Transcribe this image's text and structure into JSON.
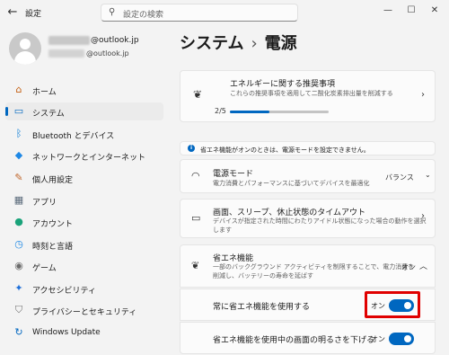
{
  "window": {
    "title": "設定",
    "back_icon": "back-arrow-icon"
  },
  "search": {
    "placeholder": "設定の検索"
  },
  "account": {
    "email_primary": "@outlook.jp",
    "email_secondary": "@outlook.jp"
  },
  "sidebar": {
    "items": [
      {
        "label": "ホーム",
        "icon": "home-icon",
        "color": "#c45f12"
      },
      {
        "label": "システム",
        "icon": "monitor-icon",
        "color": "#0067c0",
        "active": true
      },
      {
        "label": "Bluetooth とデバイス",
        "icon": "bluetooth-icon",
        "color": "#0078d4"
      },
      {
        "label": "ネットワークとインターネット",
        "icon": "wifi-icon",
        "color": "#1e88e5"
      },
      {
        "label": "個人用設定",
        "icon": "brush-icon",
        "color": "#c0652a"
      },
      {
        "label": "アプリ",
        "icon": "apps-icon",
        "color": "#5b6b7b"
      },
      {
        "label": "アカウント",
        "icon": "person-icon",
        "color": "#1aa37a"
      },
      {
        "label": "時刻と言語",
        "icon": "globe-clock-icon",
        "color": "#1e88e5"
      },
      {
        "label": "ゲーム",
        "icon": "gamepad-icon",
        "color": "#6b6b6b"
      },
      {
        "label": "アクセシビリティ",
        "icon": "accessibility-icon",
        "color": "#1e6fd9"
      },
      {
        "label": "プライバシーとセキュリティ",
        "icon": "shield-icon",
        "color": "#707070"
      },
      {
        "label": "Windows Update",
        "icon": "update-icon",
        "color": "#0067c0"
      }
    ]
  },
  "breadcrumb": {
    "parent": "システム",
    "separator": "›",
    "current": "電源"
  },
  "energy_card": {
    "title": "エネルギーに関する推奨事項",
    "description": "これらの推奨事項を適用して二酸化炭素排出量を削減する",
    "progress_text": "2/5",
    "progress_value": 0.4
  },
  "info_bar": {
    "text": "省エネ機能がオンのときは、電源モードを設定できません。"
  },
  "power_mode": {
    "title": "電源モード",
    "description": "電力消費とパフォーマンスに基づいてデバイスを最適化",
    "value": "バランス"
  },
  "screen_sleep": {
    "title": "画面、スリープ、休止状態のタイムアウト",
    "description_1": "デバイスが指定された時間にわたりアイドル状態になった場合の動作を選択",
    "description_2": "します"
  },
  "energy_saver": {
    "title": "省エネ機能",
    "description_1": "一部のバックグラウンド アクティビティを制限することで、電力消費を",
    "description_2": "削減し、バッテリーの寿命を延ばす",
    "status": "オン"
  },
  "always_use": {
    "label": "常に省エネ機能を使用する",
    "state": "オン"
  },
  "lower_brightness": {
    "label": "省エネ機能を使用中の画面の明るさを下げる",
    "state": "オン"
  }
}
